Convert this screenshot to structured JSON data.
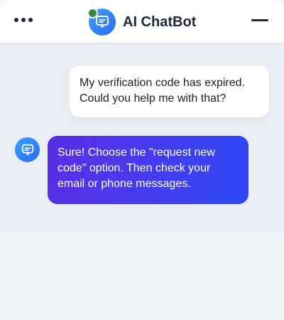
{
  "header": {
    "title": "AI ChatBot",
    "menu_icon": "more-horizontal-icon",
    "minimize_icon": "minimize-icon",
    "status": "online",
    "avatar_icon": "chat-bubble-icon"
  },
  "messages": [
    {
      "sender": "user",
      "text": "My verification code has expired. Could you help me with that?"
    },
    {
      "sender": "bot",
      "text": "Sure! Choose the \"request new code\" option. Then check your email or phone messages."
    }
  ],
  "colors": {
    "accent_blue": "#2b6cf0",
    "bot_bubble_start": "#5a2ee6",
    "bot_bubble_end": "#2f49f7",
    "online": "#2e8b3e"
  }
}
